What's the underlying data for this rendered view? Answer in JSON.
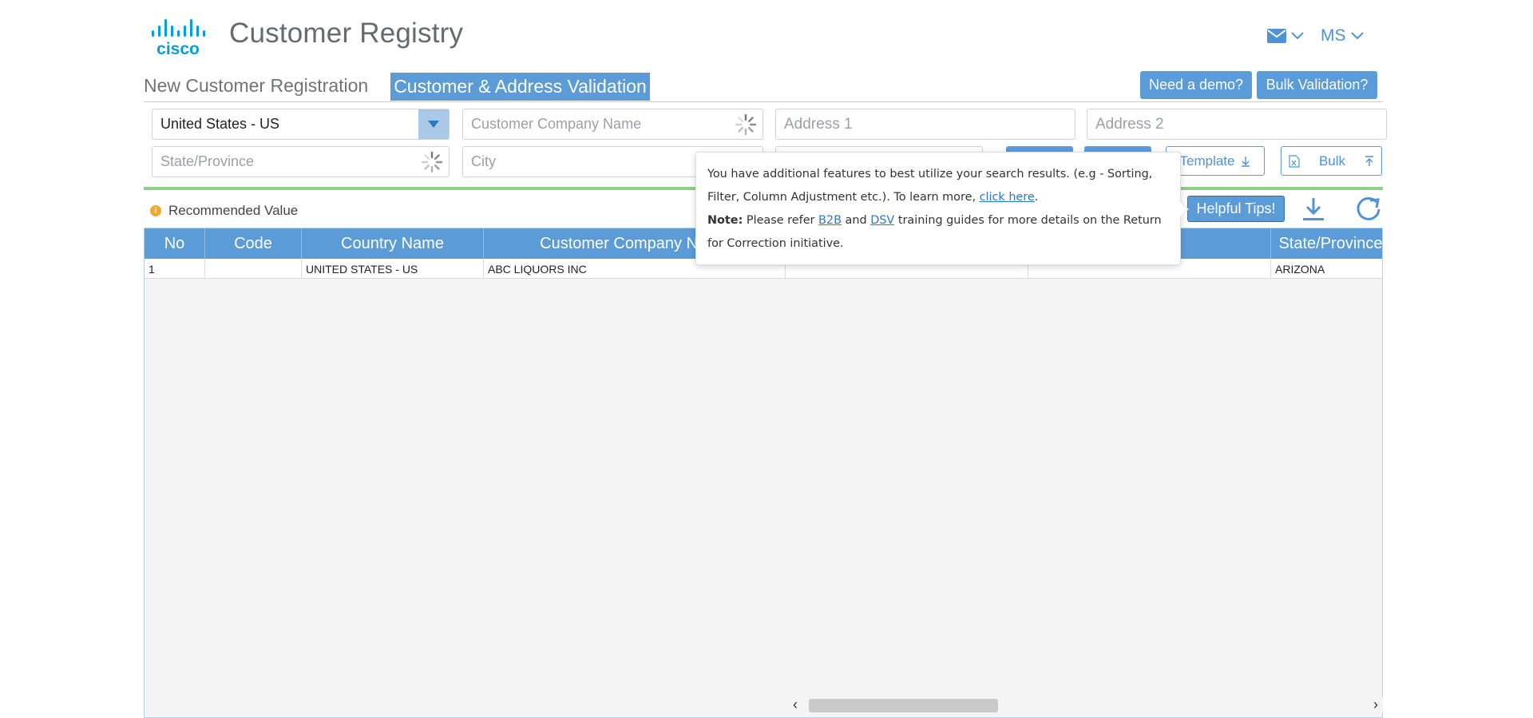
{
  "header": {
    "brand": "cisco",
    "app_title": "Customer Registry",
    "user_initials": "MS"
  },
  "tabs": {
    "new_registration": "New Customer Registration",
    "validation": "Customer & Address Validation"
  },
  "top_buttons": {
    "demo": "Need a demo?",
    "bulk_validation": "Bulk Validation?"
  },
  "search": {
    "country_value": "United States - US",
    "company_placeholder": "Customer Company Name",
    "address1_placeholder": "Address 1",
    "address2_placeholder": "Address 2",
    "state_placeholder": "State/Province",
    "city_placeholder": "City",
    "template_label": "Template",
    "bulk_label": "Bulk"
  },
  "results": {
    "recommended_label": "Recommended Value",
    "helpful_tips": "Helpful Tips!",
    "columns": [
      "No",
      "Code",
      "Country Name",
      "Customer Company Name",
      "",
      "",
      "State/Province"
    ],
    "rows": [
      [
        "1",
        "",
        "UNITED STATES - US",
        "ABC LIQUORS INC",
        "",
        "",
        "ARIZONA"
      ]
    ]
  },
  "tooltip": {
    "line1_pre": "You have additional features to best utilize your search results. (e.g - Sorting, Filter, Column Adjustment etc.). To learn more, ",
    "line1_link": "click here",
    "line1_post": ".",
    "note_label": "Note:",
    "note_pre": " Please refer ",
    "b2b": "B2B",
    "and": " and ",
    "dsv": "DSV",
    "note_post": " training guides for more details on the Return for Correction initiative."
  },
  "colors": {
    "accent": "#5a9bd8",
    "logo": "#049fd9",
    "green_bar": "#8fcd88",
    "recommended_dot": "#f0a830"
  }
}
